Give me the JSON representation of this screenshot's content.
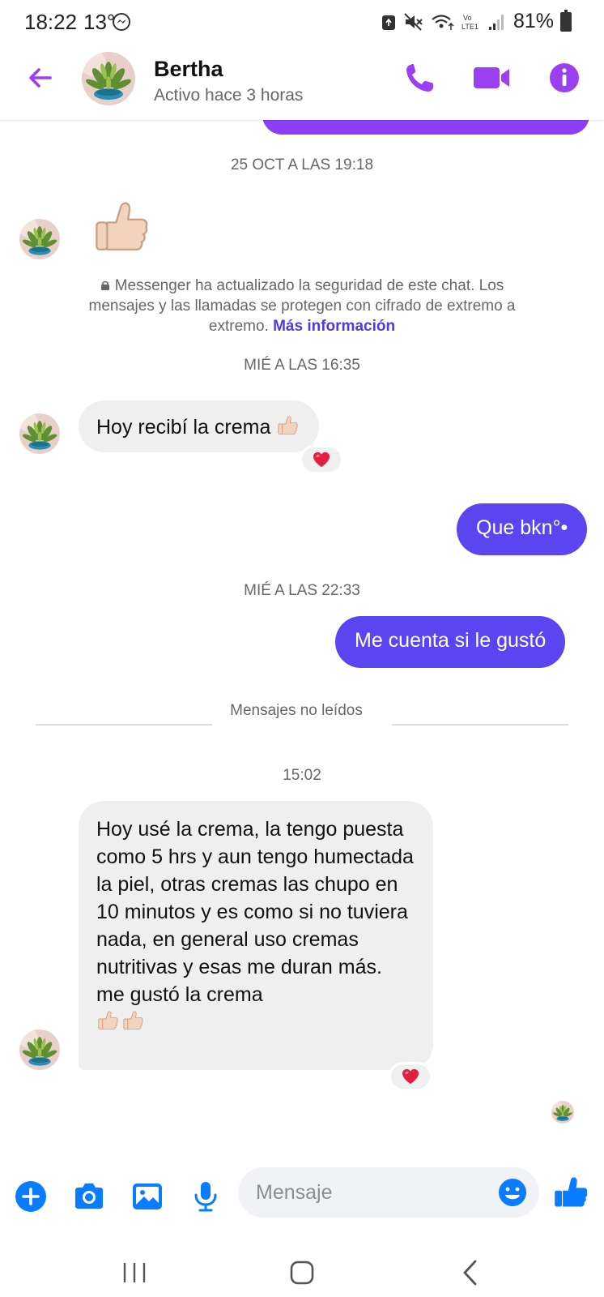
{
  "status_bar": {
    "time": "18:22",
    "temperature": "13°",
    "battery": "81%",
    "messenger_notification_icon": "messenger-icon"
  },
  "header": {
    "contact_name": "Bertha",
    "contact_status": "Activo hace 3 horas",
    "back_icon": "arrow-left-icon",
    "call_icon": "phone-icon",
    "video_icon": "video-camera-icon",
    "info_icon": "info-icon"
  },
  "conversation": {
    "timestamp_1": "25 OCT A LAS 19:18",
    "encryption_notice": "Messenger ha actualizado la seguridad de este chat. Los mensajes y las llamadas se protegen con cifrado de extremo a extremo.",
    "encryption_link": "Más información",
    "timestamp_2": "MIÉ A LAS 16:35",
    "msg_received_1": "Hoy recibí la crema",
    "msg_sent_1": "Que bkn°•",
    "timestamp_3": "MIÉ A LAS 22:33",
    "msg_sent_2": "Me cuenta si le gustó",
    "unread_divider": "Mensajes no leídos",
    "timestamp_4": "15:02",
    "msg_received_2": "Hoy usé la crema, la tengo puesta como 5 hrs y aun tengo humectada la piel, otras cremas las chupo en 10 minutos y es como  si no tuviera nada, en general uso cremas nutritivas y esas me duran más. me gustó la crema"
  },
  "composer": {
    "placeholder": "Mensaje",
    "value": "",
    "icons": [
      "plus-icon",
      "camera-icon",
      "image-icon",
      "microphone-icon",
      "emoji-icon",
      "thumbs-up-icon"
    ]
  },
  "colors": {
    "accent": "#9b3ff2",
    "sent_bubble": "#5b45f0",
    "received_bubble": "#efefef",
    "link": "#4f3ae3",
    "composer_icon": "#0a7cff"
  }
}
